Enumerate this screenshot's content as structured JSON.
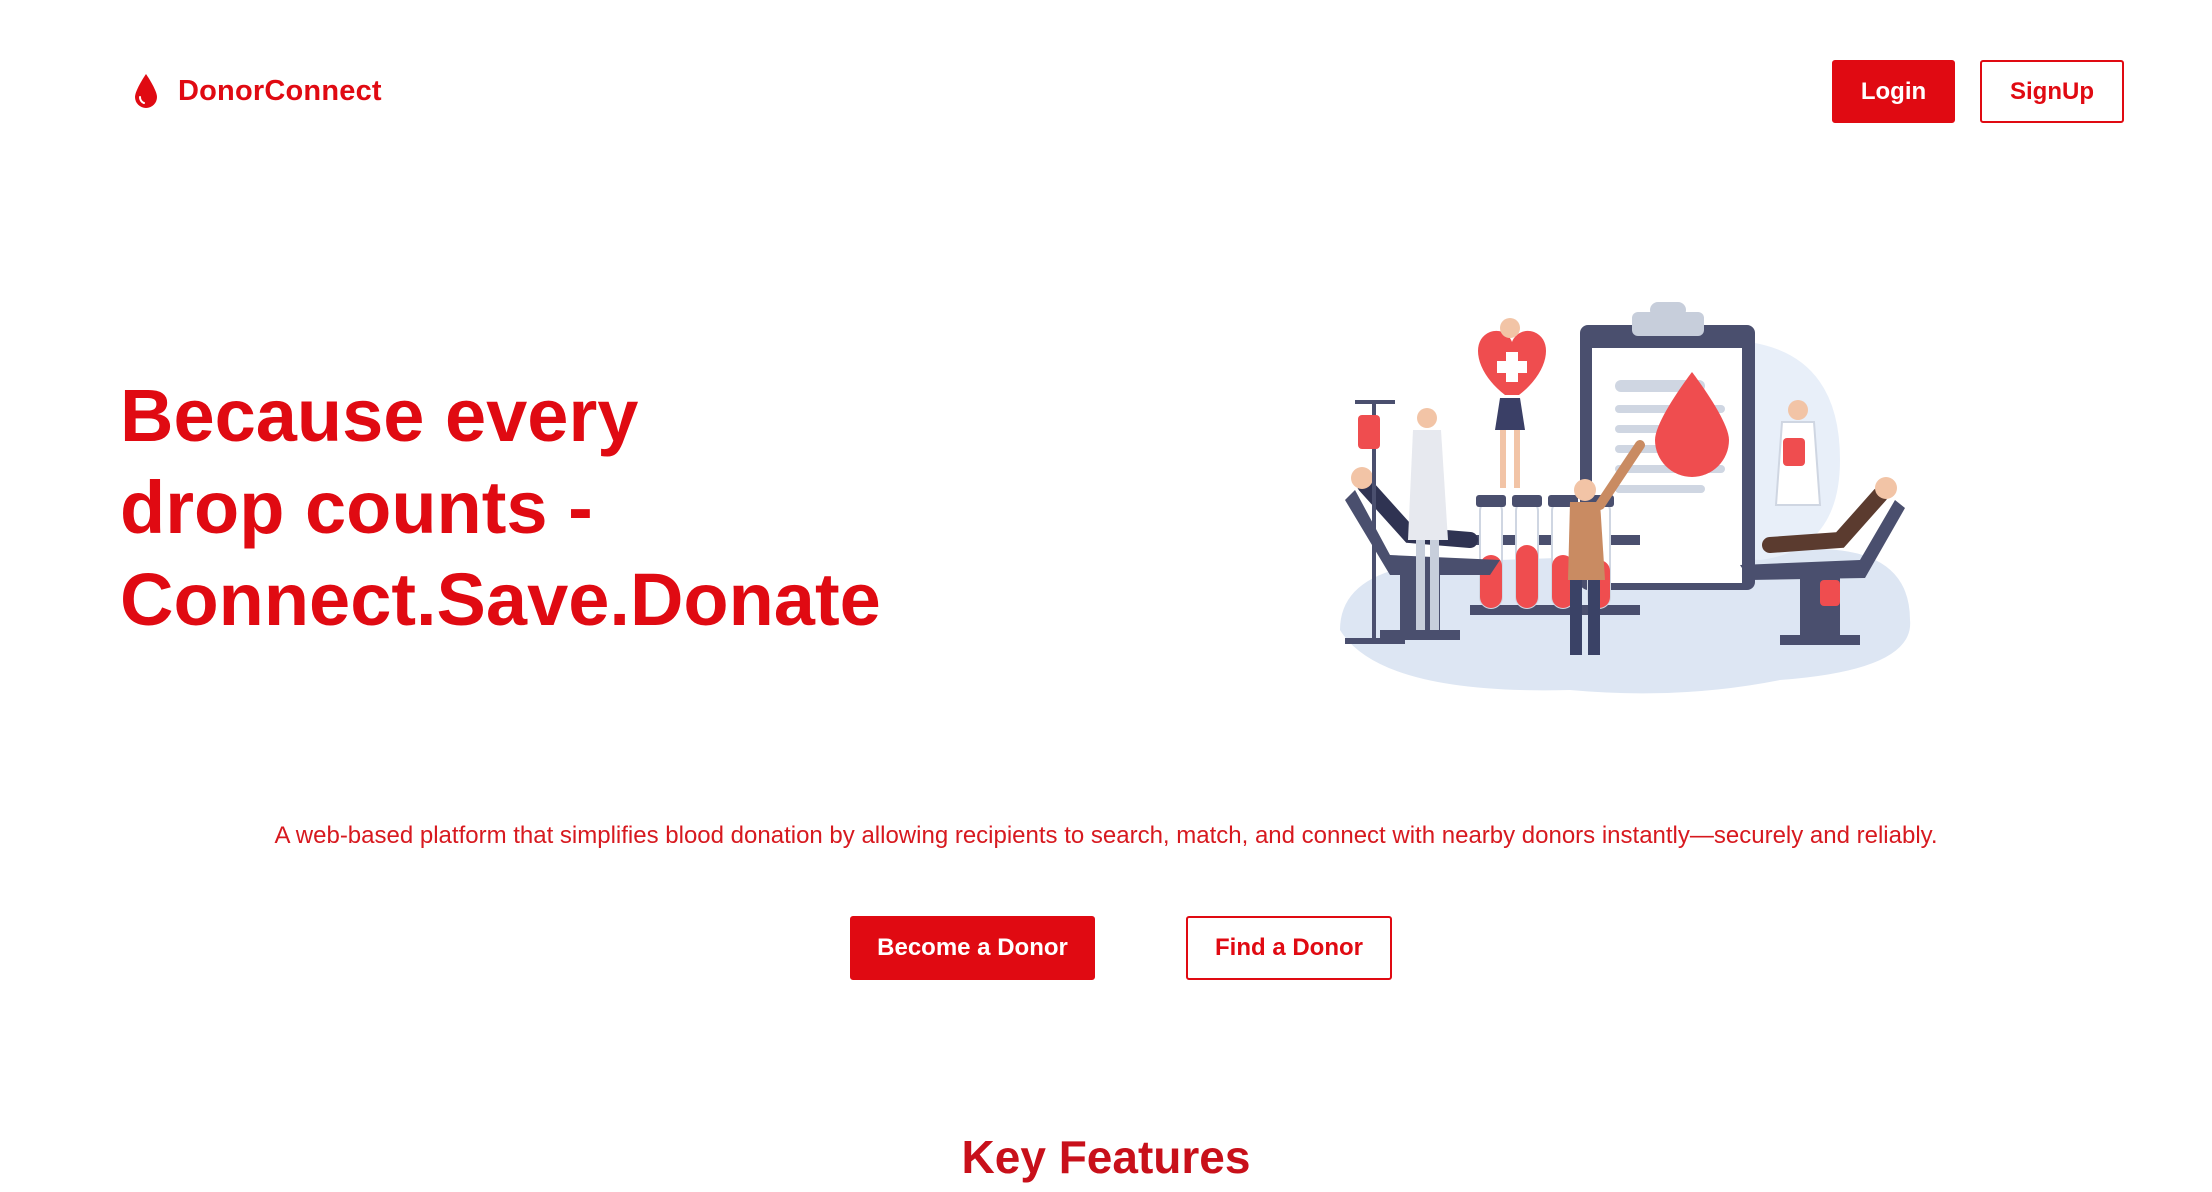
{
  "header": {
    "brand_name": "DonorConnect",
    "login_label": "Login",
    "signup_label": "SignUp"
  },
  "hero": {
    "title_lines": [
      "Because every",
      "drop counts -",
      "Connect.Save.Donate"
    ],
    "tagline": "A web-based platform that simplifies blood donation by allowing recipients to search, match, and connect with nearby donors instantly—securely and reliably.",
    "primary_cta": "Become a Donor",
    "secondary_cta": "Find a Donor"
  },
  "sections": {
    "key_features_title": "Key Features"
  },
  "theme": {
    "accent": "#e00a12"
  },
  "icons": {
    "brand": "blood-drop-icon"
  }
}
